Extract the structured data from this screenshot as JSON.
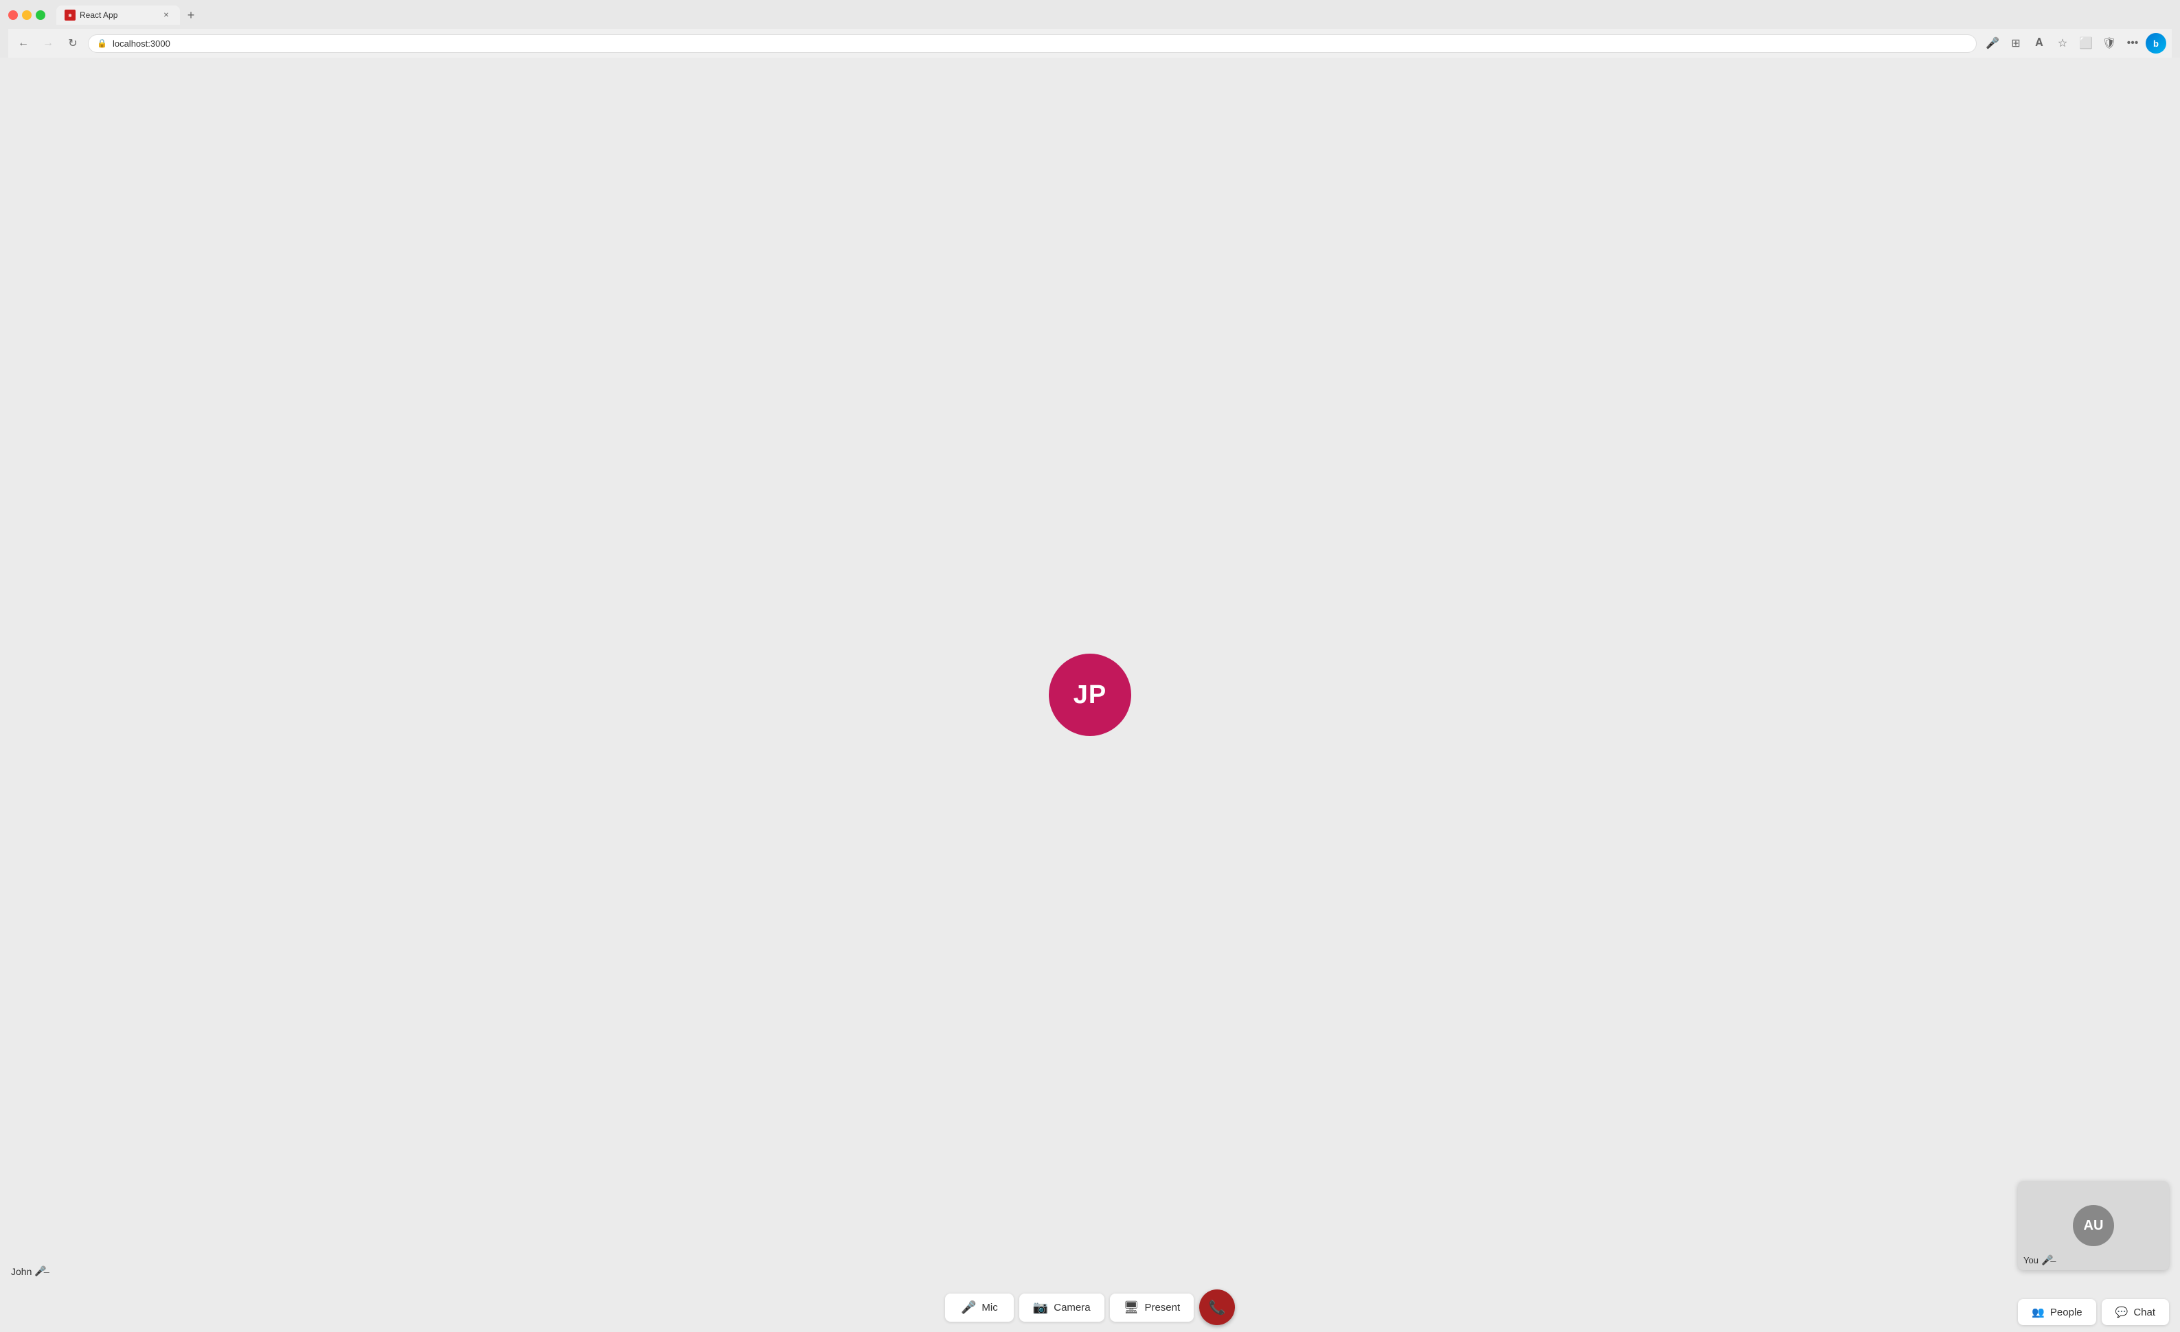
{
  "browser": {
    "tab_title": "React App",
    "tab_favicon_letter": "R",
    "url": "localhost:3000",
    "new_tab_label": "+"
  },
  "call": {
    "main_participant_initials": "JP",
    "main_participant_label": "John",
    "self_initials": "AU",
    "self_label": "You",
    "avatar_bg": "#c2185b",
    "self_avatar_bg": "#888888"
  },
  "controls": {
    "mic_label": "Mic",
    "camera_label": "Camera",
    "present_label": "Present",
    "people_label": "People",
    "chat_label": "Chat"
  }
}
